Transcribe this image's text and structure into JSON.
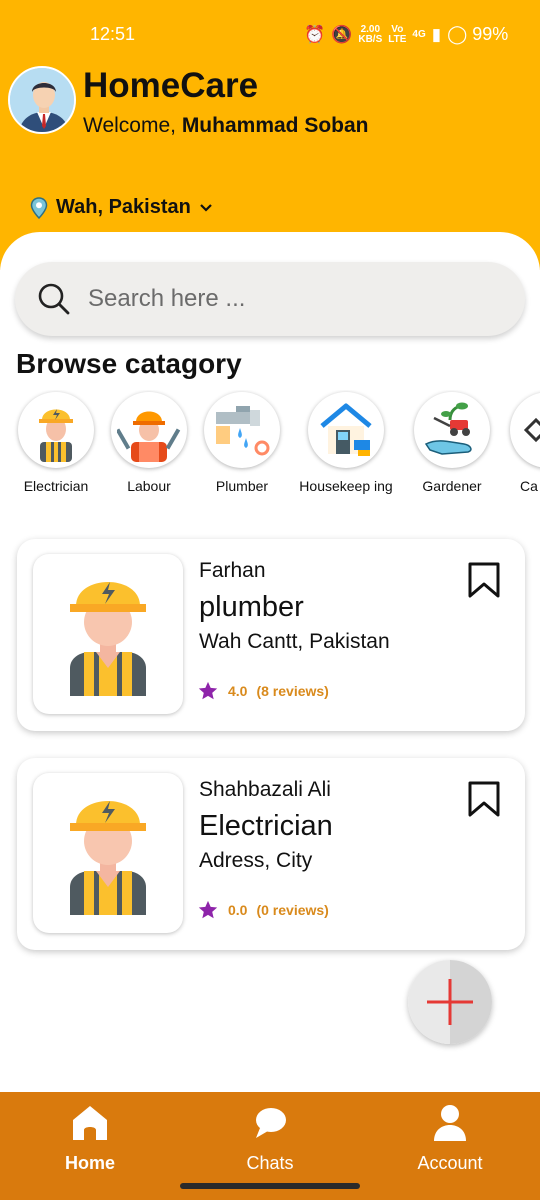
{
  "status_bar": {
    "time": "12:51",
    "net_speed_top": "2.00",
    "net_speed_bottom": "KB/S",
    "volte_top": "Vo",
    "volte_bottom": "LTE",
    "network": "4G",
    "battery": "99%"
  },
  "header": {
    "app_title": "HomeCare",
    "welcome_prefix": "Welcome, ",
    "user_name": "Muhammad Soban",
    "location": "Wah, Pakistan",
    "bg_color": "#FFB500"
  },
  "search": {
    "placeholder": "Search here ..."
  },
  "section_title": "Browse catagory",
  "categories": [
    {
      "label": "Electrician",
      "icon": "electrician-icon"
    },
    {
      "label": "Labour",
      "icon": "labour-icon"
    },
    {
      "label": "Plumber",
      "icon": "plumber-icon"
    },
    {
      "label": "Housekeep ing",
      "icon": "housekeeping-icon"
    },
    {
      "label": "Gardener",
      "icon": "gardener-icon"
    },
    {
      "label": "Ca",
      "icon": "category-icon"
    }
  ],
  "providers": [
    {
      "name": "Farhan",
      "role": "plumber",
      "address": "Wah Cantt, Pakistan",
      "rating": "4.0",
      "reviews": "(8 reviews)"
    },
    {
      "name": "Shahbazali Ali",
      "role": "Electrician",
      "address": "Adress, City",
      "rating": "0.0",
      "reviews": "(0 reviews)"
    }
  ],
  "bottom_nav": [
    {
      "label": "Home",
      "icon": "home-icon",
      "active": true
    },
    {
      "label": "Chats",
      "icon": "chat-icon",
      "active": false
    },
    {
      "label": "Account",
      "icon": "account-icon",
      "active": false
    }
  ],
  "colors": {
    "accent": "#FFB500",
    "nav": "#D97A0D",
    "rating_text": "#D98A1C",
    "star": "#8E24AA",
    "fab_plus": "#E53935"
  }
}
